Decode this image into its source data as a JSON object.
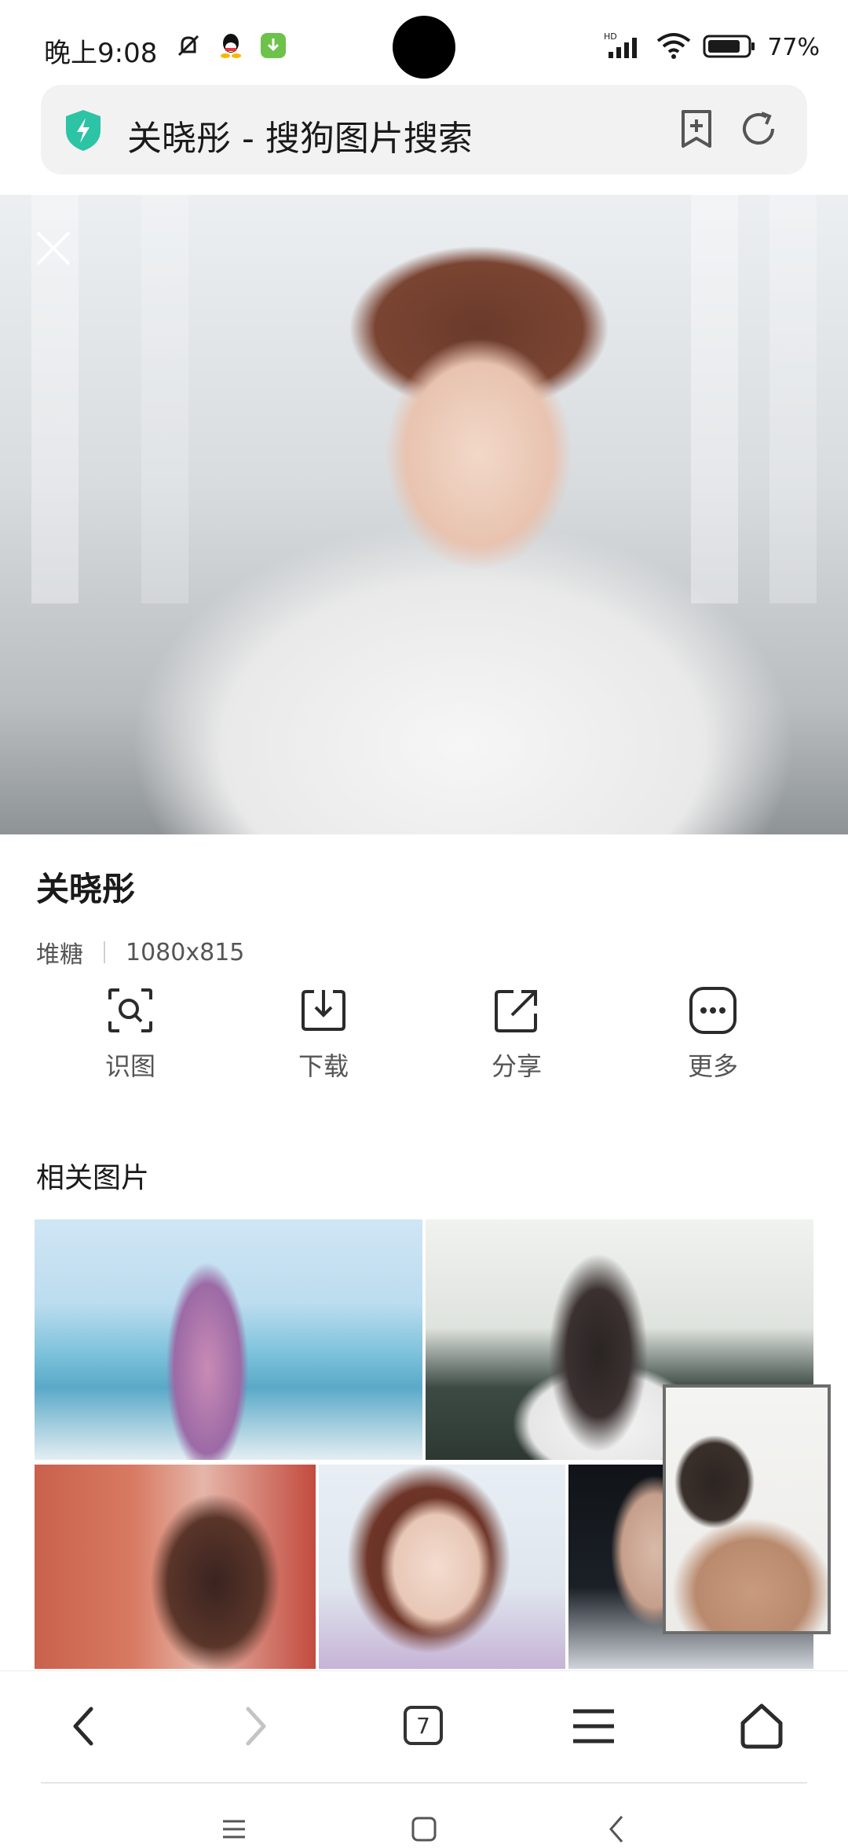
{
  "status_bar": {
    "time": "晚上9:08",
    "network": "HD",
    "battery": "77%",
    "icons": [
      "mute-icon",
      "qq-icon",
      "download-app-icon",
      "signal-icon",
      "wifi-icon",
      "battery-icon"
    ]
  },
  "address_bar": {
    "title": "关晓彤 - 搜狗图片搜索",
    "security_color": "#2dc3a5"
  },
  "image": {
    "title": "关晓彤",
    "source": "堆糖",
    "dimensions": "1080x815"
  },
  "actions": [
    {
      "label": "识图",
      "icon": "image-search-icon"
    },
    {
      "label": "下载",
      "icon": "download-icon"
    },
    {
      "label": "分享",
      "icon": "share-icon"
    },
    {
      "label": "更多",
      "icon": "more-icon"
    }
  ],
  "related": {
    "title": "相关图片"
  },
  "toolbar": {
    "tab_count": "7"
  }
}
